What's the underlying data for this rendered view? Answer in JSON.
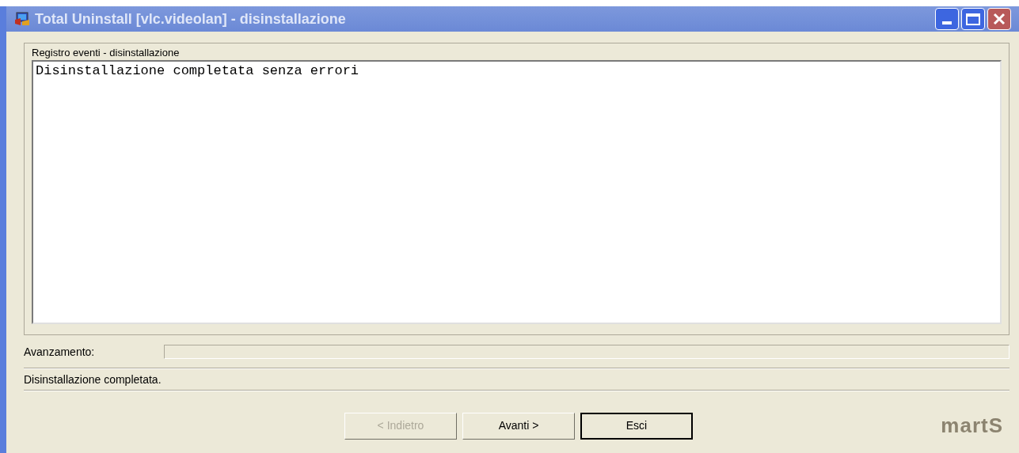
{
  "window": {
    "title": "Total Uninstall [vlc.videolan] - disinstallazione"
  },
  "log_group": {
    "label": "Registro eventi - disinstallazione",
    "lines": [
      "Disinstallazione completata senza errori"
    ]
  },
  "progress": {
    "label": "Avanzamento:",
    "level": 0
  },
  "status": "Disinstallazione completata.",
  "buttons": [
    {
      "label": "< Indietro",
      "disabled": true,
      "default": false
    },
    {
      "label": "Avanti >",
      "disabled": false,
      "default": false
    },
    {
      "label": "Esci",
      "disabled": false,
      "default": true
    }
  ],
  "brand": "martS"
}
